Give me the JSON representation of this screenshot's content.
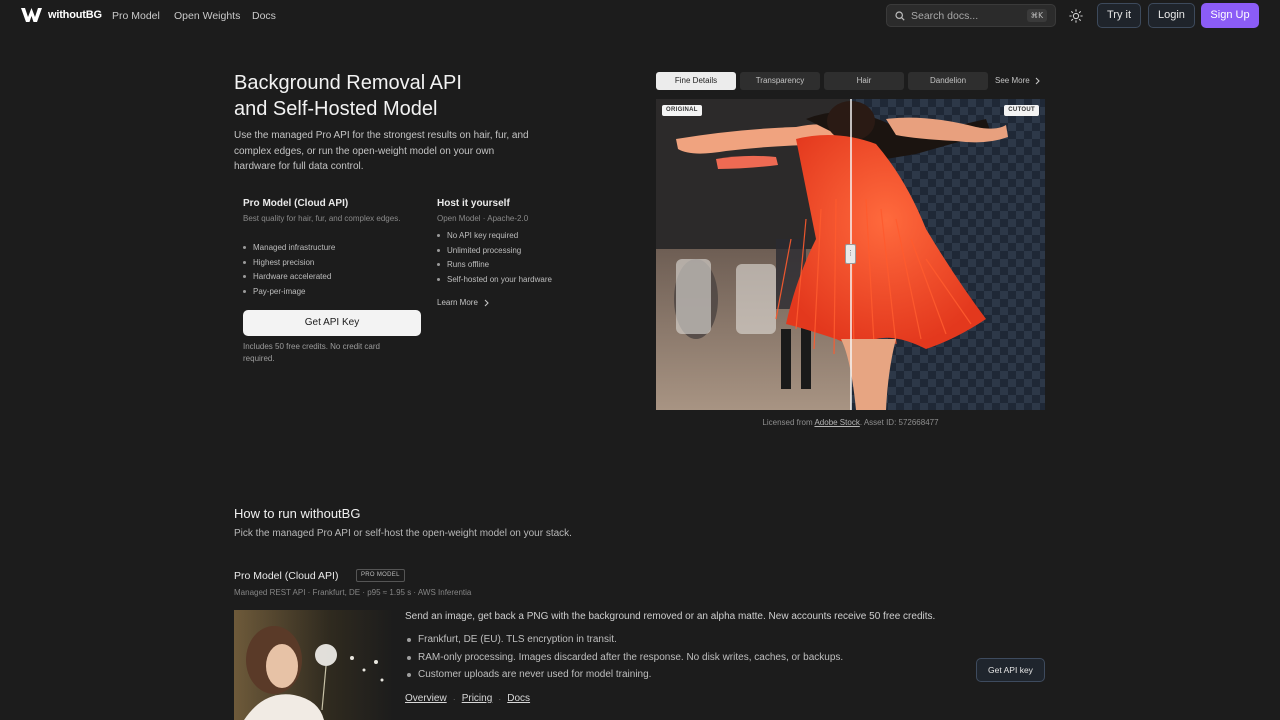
{
  "nav": {
    "brand": "withoutBG",
    "links": [
      "Pro Model",
      "Open Weights",
      "Docs"
    ],
    "search_placeholder": "Search docs...",
    "search_shortcut": "⌘K",
    "try_label": "Try it",
    "login_label": "Login",
    "signup_label": "Sign Up",
    "accent": "#8b5cf6"
  },
  "hero": {
    "title_line1": "Background Removal API",
    "title_line2": "and Self-Hosted Model",
    "subtitle": "Use the managed Pro API for the strongest results on hair, fur, and complex edges, or run the open-weight model on your own hardware for full data control.",
    "pro": {
      "heading": "Pro Model (Cloud API)",
      "sub": "Best quality for hair, fur, and complex edges.",
      "bullets": [
        "Managed infrastructure",
        "Highest precision",
        "Hardware accelerated",
        "Pay-per-image"
      ],
      "button": "Get API Key",
      "note": "Includes 50 free credits. No credit card required."
    },
    "host": {
      "heading": "Host it yourself",
      "sub": "Open Model · Apache-2.0",
      "bullets": [
        "No API key required",
        "Unlimited processing",
        "Runs offline",
        "Self-hosted on your hardware"
      ],
      "link": "Learn More"
    }
  },
  "viewer": {
    "tabs": [
      "Fine Details",
      "Transparency",
      "Hair",
      "Dandelion"
    ],
    "active_tab": "Fine Details",
    "see_more": "See More",
    "label_left": "ORIGINAL",
    "label_right": "CUTOUT",
    "credit_prefix": "Licensed from",
    "credit_link": "Adobe Stock",
    "credit_suffix": ". Asset ID: 572668477"
  },
  "howto": {
    "title": "How to run withoutBG",
    "subtitle": "Pick the managed Pro API or self-host the open-weight model on your stack.",
    "pro_title": "Pro Model (Cloud API)",
    "pro_badge": "PRO MODEL",
    "pro_meta": "Managed REST API · Frankfurt, DE · p95 ≈ 1.95 s · AWS Inferentia",
    "description": "Send an image, get back a PNG with the background removed or an alpha matte. New accounts receive 50 free credits.",
    "bullets": [
      "Frankfurt, DE (EU). TLS encryption in transit.",
      "RAM-only processing. Images discarded after the response. No disk writes, caches, or backups.",
      "Customer uploads are never used for model training."
    ],
    "links": [
      "Overview",
      "Pricing",
      "Docs"
    ],
    "button": "Get API key"
  }
}
